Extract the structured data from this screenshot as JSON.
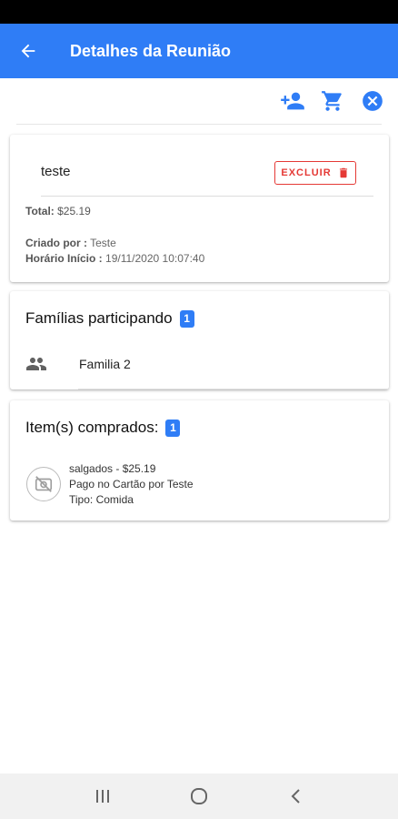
{
  "app_bar": {
    "title": "Detalhes da Reunião",
    "color": "#2f7df6"
  },
  "actions": {
    "icons": [
      "person-add-icon",
      "cart-icon",
      "close-circle-icon"
    ]
  },
  "meeting": {
    "name": "teste",
    "delete_label": "EXCLUIR",
    "total_label": "Total:",
    "total_value": "$25.19",
    "created_by_label": "Criado por :",
    "created_by_value": "Teste",
    "start_label": "Horário Início :",
    "start_value": "19/11/2020 10:07:40"
  },
  "families": {
    "title": "Famílias participando",
    "count": "1",
    "items": [
      {
        "name": "Familia 2"
      }
    ]
  },
  "purchased": {
    "title": "Item(s) comprados:",
    "count": "1",
    "items": [
      {
        "line1": "salgados - $25.19",
        "line2": "Pago no Cartão por Teste",
        "line3": "Tipo: Comida"
      }
    ]
  },
  "colors": {
    "accent": "#2f7df6",
    "danger": "#e53935"
  }
}
